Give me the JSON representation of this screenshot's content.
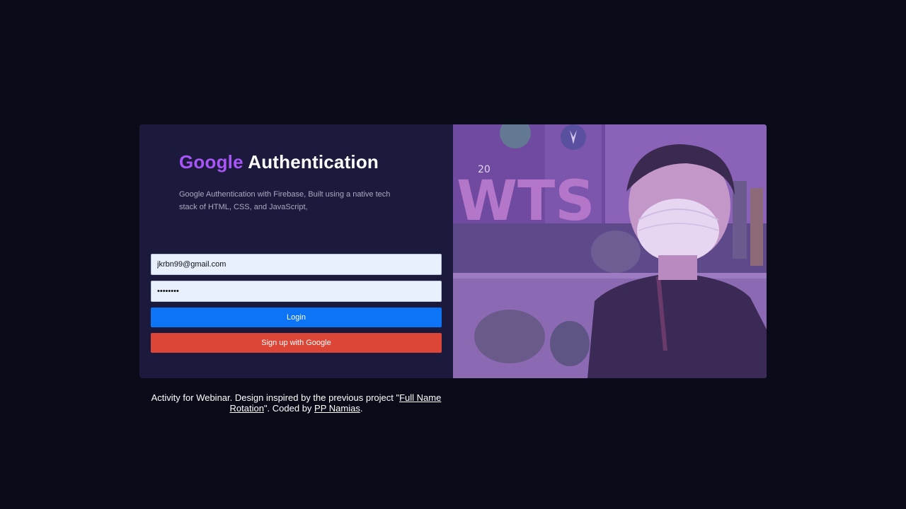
{
  "header": {
    "title_accent": "Google",
    "title_rest": " Authentication",
    "description": "Google Authentication with Firebase, Built using a native tech stack of HTML, CSS, and JavaScript,"
  },
  "form": {
    "email_value": "jkrbn99@gmail.com",
    "password_value": "••••••••",
    "login_label": "Login",
    "google_label": "Sign up with Google"
  },
  "photo": {
    "alt": "selfie-photo",
    "sign_letters": "WTS",
    "sign_number": "20"
  },
  "footer": {
    "text_1": "Activity for Webinar. Design inspired by the previous project \"",
    "link_project": "Full Name Rotation",
    "text_2": "\". Coded by ",
    "link_author": "PP Namias",
    "text_3": "."
  },
  "colors": {
    "background": "#0a0b18",
    "panel": "#1c1a3c",
    "accent": "#a855f7",
    "login_button": "#0d74f5",
    "google_button": "#dc4637",
    "photo_tint": "#7a52a8"
  }
}
